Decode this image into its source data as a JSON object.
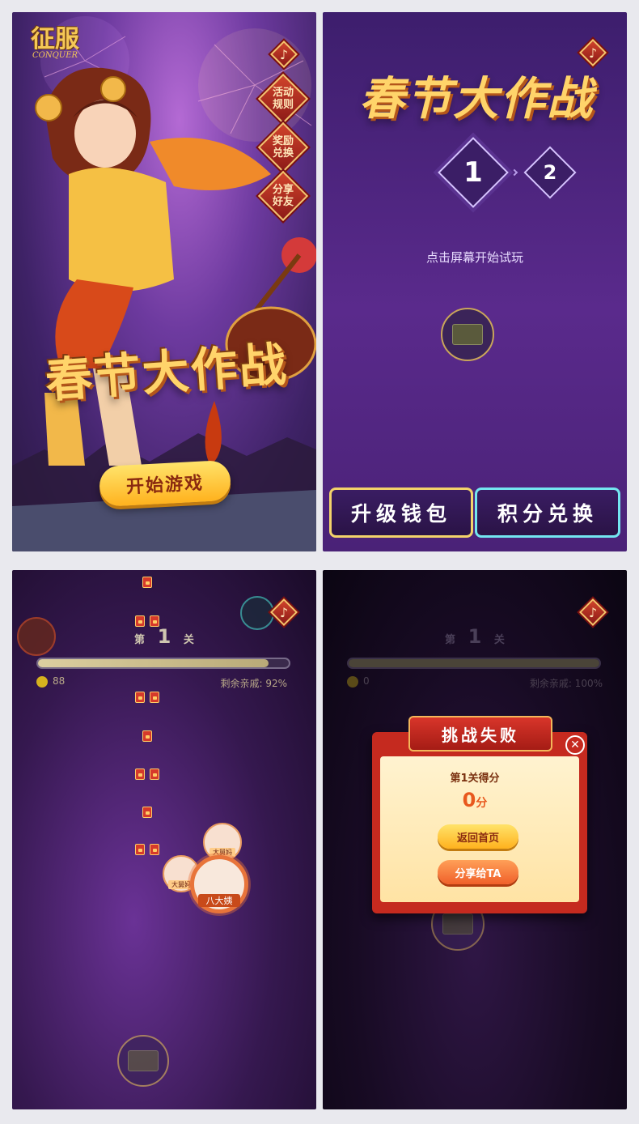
{
  "panel1": {
    "logo": "征服",
    "logo_sub": "CONQUER",
    "side_buttons": [
      "活动\n规则",
      "奖励\n兑换",
      "分享\n好友"
    ],
    "title": "春节大作战",
    "start_button": "开始游戏",
    "music_icon": "music-note-icon"
  },
  "panel2": {
    "title": "春节大作战",
    "step1": "1",
    "step2": "2",
    "hint": "点击屏幕开始试玩",
    "upgrade_button": "升级钱包",
    "exchange_button": "积分兑换"
  },
  "panel3": {
    "level_prefix": "第",
    "level_num": "1",
    "level_suffix": "关",
    "coins": "88",
    "affection_label": "剩余亲戚: 92%",
    "progress": 0.92,
    "relatives": [
      "大舅妈",
      "大舅妈",
      "八大姨"
    ]
  },
  "panel4": {
    "level_prefix": "第",
    "level_num": "1",
    "level_suffix": "关",
    "coins": "0",
    "affection_label": "剩余亲戚: 100%",
    "progress": 1.0,
    "dialog_title": "挑战失败",
    "score_label": "第1关得分",
    "score_value": "0",
    "score_unit": "分",
    "home_button": "返回首页",
    "share_button": "分享给TA"
  },
  "colors": {
    "accent_gold": "#ffd46a",
    "button_yellow": "#ffc233",
    "button_orange": "#f07a2a",
    "dialog_red": "#c52a1f",
    "dialog_cream": "#fff0c8",
    "progress_fill": "#c9b98a"
  }
}
